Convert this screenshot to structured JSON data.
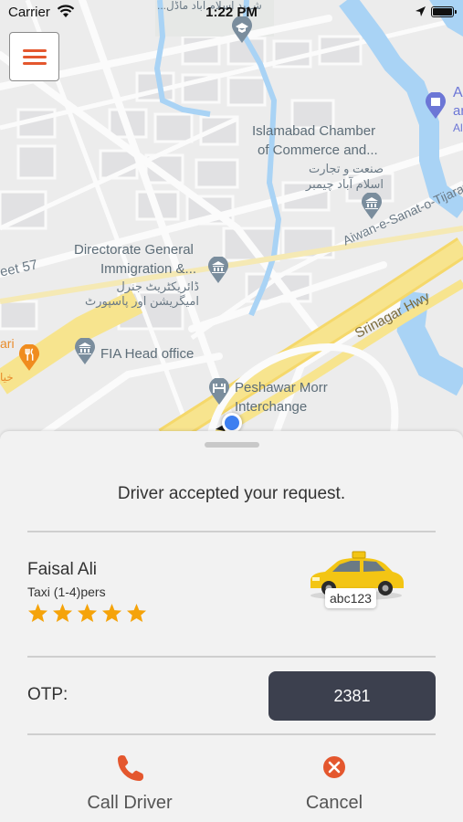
{
  "status_bar": {
    "carrier": "Carrier",
    "time": "1:22 PM"
  },
  "map": {
    "labels": {
      "chamber_en_1": "Islamabad Chamber",
      "chamber_en_2": "of Commerce and...",
      "chamber_ur_1": "صنعت و تجارت",
      "chamber_ur_2": "اسلام آباد چیمبر",
      "dgi_en_1": "Directorate General",
      "dgi_en_2": "Immigration &...",
      "dgi_ur_1": "ڈائریکٹریٹ جنرل",
      "dgi_ur_2": "امیگریشن اور پاسپورٹ",
      "fia": "FIA Head office",
      "peshawar_1": "Peshawar Morr",
      "peshawar_2": "Interchange",
      "aiwan": "Aiwan-e-Sanat-o-Tijarat",
      "srinagar": "Srinagar Hwy",
      "street57": "eet 57",
      "top_urdu": "شہید اسلام آباد ماڈل...",
      "right_a": "A",
      "right_ar": "ar",
      "right_al": "Al",
      "left_ari": "ari",
      "left_khy": "خیا"
    }
  },
  "menu_icon": "hamburger-menu-icon",
  "panel": {
    "status_message": "Driver accepted your request.",
    "driver": {
      "name": "Faisal Ali",
      "vehicle_type": "Taxi (1-4)pers",
      "rating": 5,
      "plate": "abc123"
    },
    "otp": {
      "label": "OTP:",
      "value": "2381"
    },
    "actions": {
      "call_label": "Call Driver",
      "cancel_label": "Cancel"
    }
  },
  "colors": {
    "accent": "#e4572e",
    "star": "#f5a30a",
    "otp_bg": "#3c404e",
    "water": "#a9d3f5",
    "highway": "#f7e48e",
    "user_location": "#3d7ff0"
  }
}
